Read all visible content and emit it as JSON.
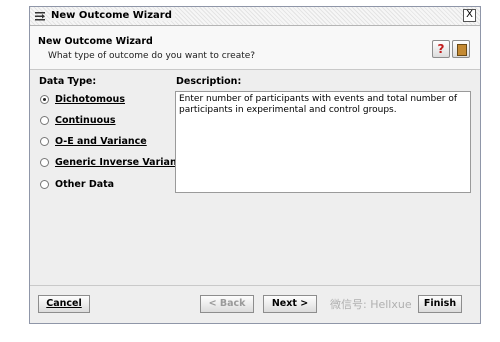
{
  "window": {
    "title": "New Outcome Wizard",
    "close_label": "X"
  },
  "header": {
    "title": "New Outcome Wizard",
    "subtitle": "What type of outcome do you want to create?",
    "help_label": "?"
  },
  "data_type": {
    "label": "Data Type:",
    "options": [
      {
        "label": "Dichotomous",
        "selected": true
      },
      {
        "label": "Continuous",
        "selected": false
      },
      {
        "label": "O-E and Variance",
        "selected": false
      },
      {
        "label": "Generic Inverse Variance",
        "selected": false
      },
      {
        "label": "Other Data",
        "selected": false
      }
    ]
  },
  "description": {
    "label": "Description:",
    "text": "Enter number of participants with events and total number of participants in experimental and control groups."
  },
  "buttons": {
    "cancel": "Cancel",
    "back": "< Back",
    "next": "Next >",
    "finish": "Finish"
  },
  "watermark": "微信号: Hellxue"
}
